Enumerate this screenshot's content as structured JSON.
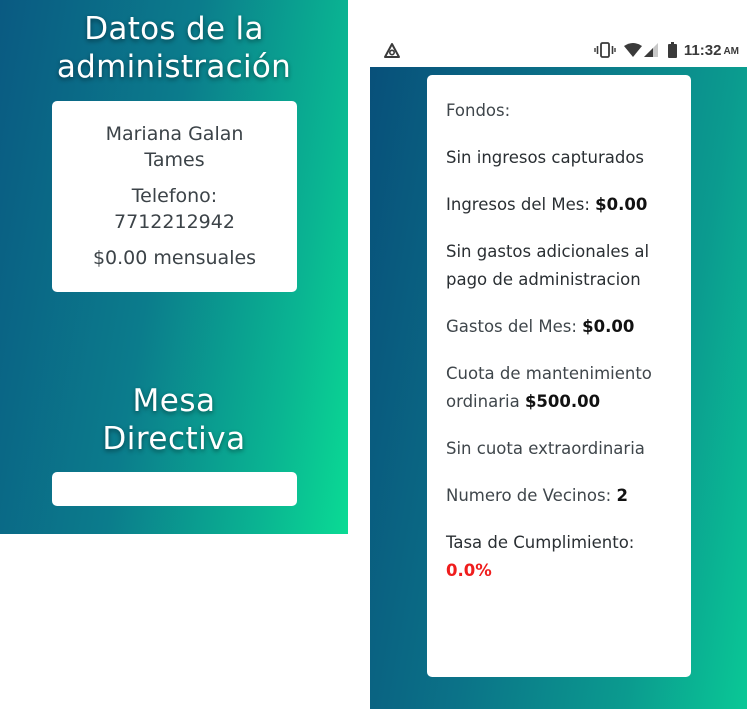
{
  "left_panel": {
    "title_line1": "Datos de la",
    "title_line2": "administración",
    "admin_card": {
      "name": "Mariana Galan Tames",
      "phone_label": "Telefono:",
      "phone_number": "7712212942",
      "monthly_fee": "$0.00 mensuales"
    },
    "mesa_title_line1": "Mesa",
    "mesa_title_line2": "Directiva"
  },
  "status_bar": {
    "time": "11:32",
    "ampm": "AM",
    "icons": [
      "app-notification-icon",
      "vibrate-icon",
      "wifi-icon",
      "signal-icon",
      "battery-icon"
    ]
  },
  "info_card": {
    "fondos_label": "Fondos:",
    "sin_ingresos": "Sin ingresos capturados",
    "ingresos_label": "Ingresos del Mes:",
    "ingresos_value": "$0.00",
    "sin_gastos": "Sin gastos adicionales al pago de administracion",
    "gastos_label": "Gastos del Mes:",
    "gastos_value": "$0.00",
    "cuota_label": "Cuota de mantenimiento ordinaria",
    "cuota_value": "$500.00",
    "sin_cuota_extra": "Sin cuota extraordinaria",
    "vecinos_label": "Numero de Vecinos:",
    "vecinos_value": "2",
    "tasa_label": "Tasa de Cumplimiento:",
    "tasa_value": "0.0%"
  },
  "colors": {
    "gradient_dark": "#0a5a82",
    "gradient_light": "#0adb94",
    "alert_red": "#ef1d1d"
  }
}
